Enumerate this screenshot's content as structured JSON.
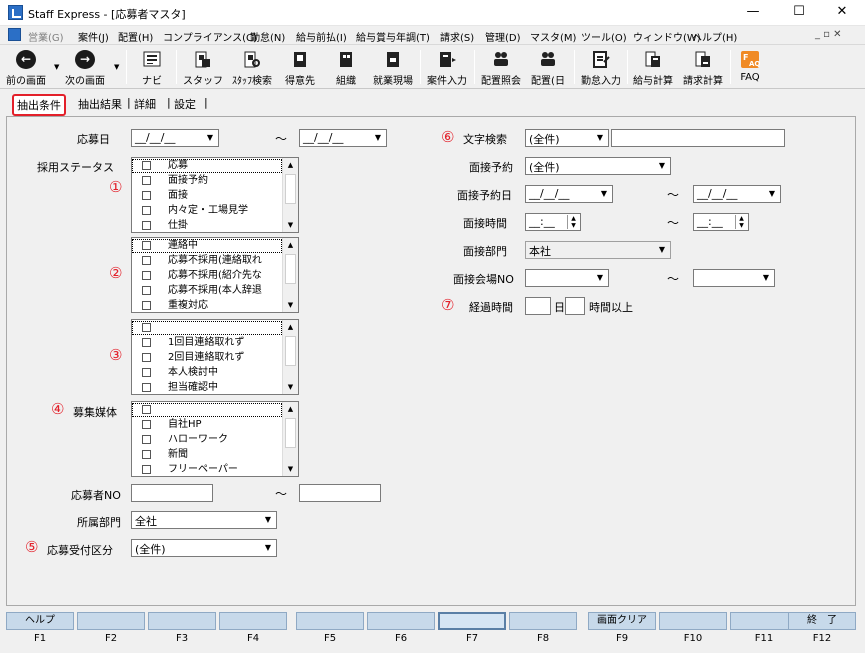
{
  "window": {
    "title": "Staff Express - [応募者マスタ]",
    "minimize": "—",
    "maximize": "☐",
    "close": "✕"
  },
  "menu": {
    "items": [
      {
        "label": "営業(G)",
        "disabled": true
      },
      {
        "label": "案件(J)"
      },
      {
        "label": "配置(H)"
      },
      {
        "label": "コンプライアンス(C)"
      },
      {
        "label": "勤怠(N)"
      },
      {
        "label": "給与前払(I)"
      },
      {
        "label": "給与賞与年調(T)"
      },
      {
        "label": "請求(S)"
      },
      {
        "label": "管理(D)"
      },
      {
        "label": "マスタ(M)"
      },
      {
        "label": "ツール(O)"
      },
      {
        "label": "ウィンドウ(W)"
      },
      {
        "label": "ヘルプ(H)"
      }
    ],
    "mdi_controls": "_ ▫ ✕"
  },
  "toolbar": {
    "items": [
      {
        "label": "前の画面",
        "icon": "back-arrow-icon"
      },
      {
        "label": "次の画面",
        "icon": "forward-arrow-icon"
      },
      {
        "label": "ナビ",
        "icon": "navi-icon"
      },
      {
        "label": "スタッフ",
        "icon": "staff-icon"
      },
      {
        "label": "ｽﾀｯﾌ検索",
        "icon": "staff-search-icon"
      },
      {
        "label": "得意先",
        "icon": "client-icon"
      },
      {
        "label": "組織",
        "icon": "organization-icon"
      },
      {
        "label": "就業現場",
        "icon": "worksite-icon"
      },
      {
        "label": "案件入力",
        "icon": "job-entry-icon"
      },
      {
        "label": "配置照会",
        "icon": "placement-inquiry-icon"
      },
      {
        "label": "配置(日",
        "icon": "placement-daily-icon"
      },
      {
        "label": "勤怠入力",
        "icon": "attendance-entry-icon"
      },
      {
        "label": "給与計算",
        "icon": "payroll-icon"
      },
      {
        "label": "請求計算",
        "icon": "billing-icon"
      },
      {
        "label": "FAQ",
        "icon": "faq-icon"
      }
    ]
  },
  "tabs": [
    "抽出条件",
    "抽出結果",
    "詳細",
    "設定"
  ],
  "form": {
    "date_blank": "__/__/__",
    "time_blank": "__:__",
    "tilde": "～",
    "apply_date_label": "応募日",
    "status_label": "採用ステータス",
    "status_list_1": [
      "応募",
      "面接予約",
      "面接",
      "内々定・工場見学",
      "仕掛"
    ],
    "status_list_2": [
      "連絡中",
      "応募不採用(連絡取れ",
      "応募不採用(紹介先な",
      "応募不採用(本人辞退",
      "重複対応"
    ],
    "status_list_3": [
      "",
      "1回目連絡取れず",
      "2回目連絡取れず",
      "本人検討中",
      "担当確認中"
    ],
    "media_label": "募集媒体",
    "media_list": [
      "",
      "自社HP",
      "ハローワーク",
      "新聞",
      "フリーペーパー"
    ],
    "applicant_no_label": "応募者NO",
    "dept_label": "所属部門",
    "dept_value": "全社",
    "reception_label": "応募受付区分",
    "reception_value": "(全件)",
    "text_search_label": "文字検索",
    "text_search_value": "(全件)",
    "interview_reservation_label": "面接予約",
    "interview_reservation_value": "(全件)",
    "interview_date_label": "面接予約日",
    "interview_time_label": "面接時間",
    "interview_dept_label": "面接部門",
    "interview_dept_value": "本社",
    "interview_venue_label": "面接会場NO",
    "elapsed_label": "経過時間",
    "elapsed_day_unit": "日",
    "elapsed_hour_unit": "時間以上"
  },
  "markers": [
    "①",
    "②",
    "③",
    "④",
    "⑤",
    "⑥",
    "⑦"
  ],
  "fkeys": [
    {
      "key": "F1",
      "label": "ヘルプ"
    },
    {
      "key": "F2",
      "label": ""
    },
    {
      "key": "F3",
      "label": ""
    },
    {
      "key": "F4",
      "label": ""
    },
    {
      "key": "F5",
      "label": ""
    },
    {
      "key": "F6",
      "label": ""
    },
    {
      "key": "F7",
      "label": ""
    },
    {
      "key": "F8",
      "label": ""
    },
    {
      "key": "F9",
      "label": "画面クリア"
    },
    {
      "key": "F10",
      "label": ""
    },
    {
      "key": "F11",
      "label": ""
    },
    {
      "key": "F12",
      "label": "終　了"
    }
  ],
  "colors": {
    "marker": "#e3202a",
    "fkey_bg": "#c7d9ea"
  }
}
